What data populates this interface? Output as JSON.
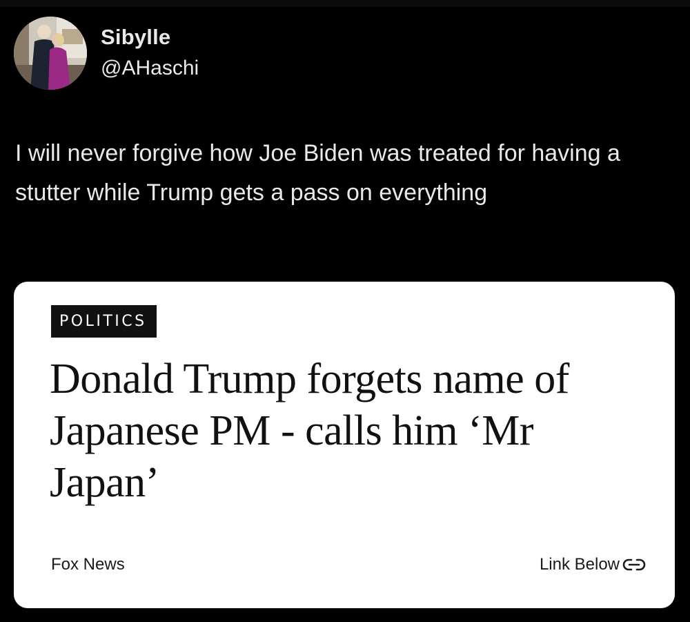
{
  "post": {
    "author": {
      "display_name": "Sibylle",
      "handle": "@AHaschi",
      "avatar_icon": "profile-photo"
    },
    "text": "I will never forgive how Joe Biden was treated for having a stutter while Trump gets a pass on everything"
  },
  "card": {
    "section_tag": "POLITICS",
    "headline": "Donald Trump forgets name of Japanese PM - calls him ‘Mr Japan’",
    "source": "Fox News",
    "link_label": "Link Below",
    "link_icon": "link-icon"
  },
  "colors": {
    "background": "#000000",
    "text": "#e7e9ea",
    "card_background": "#ffffff",
    "tag_background": "#111111"
  }
}
